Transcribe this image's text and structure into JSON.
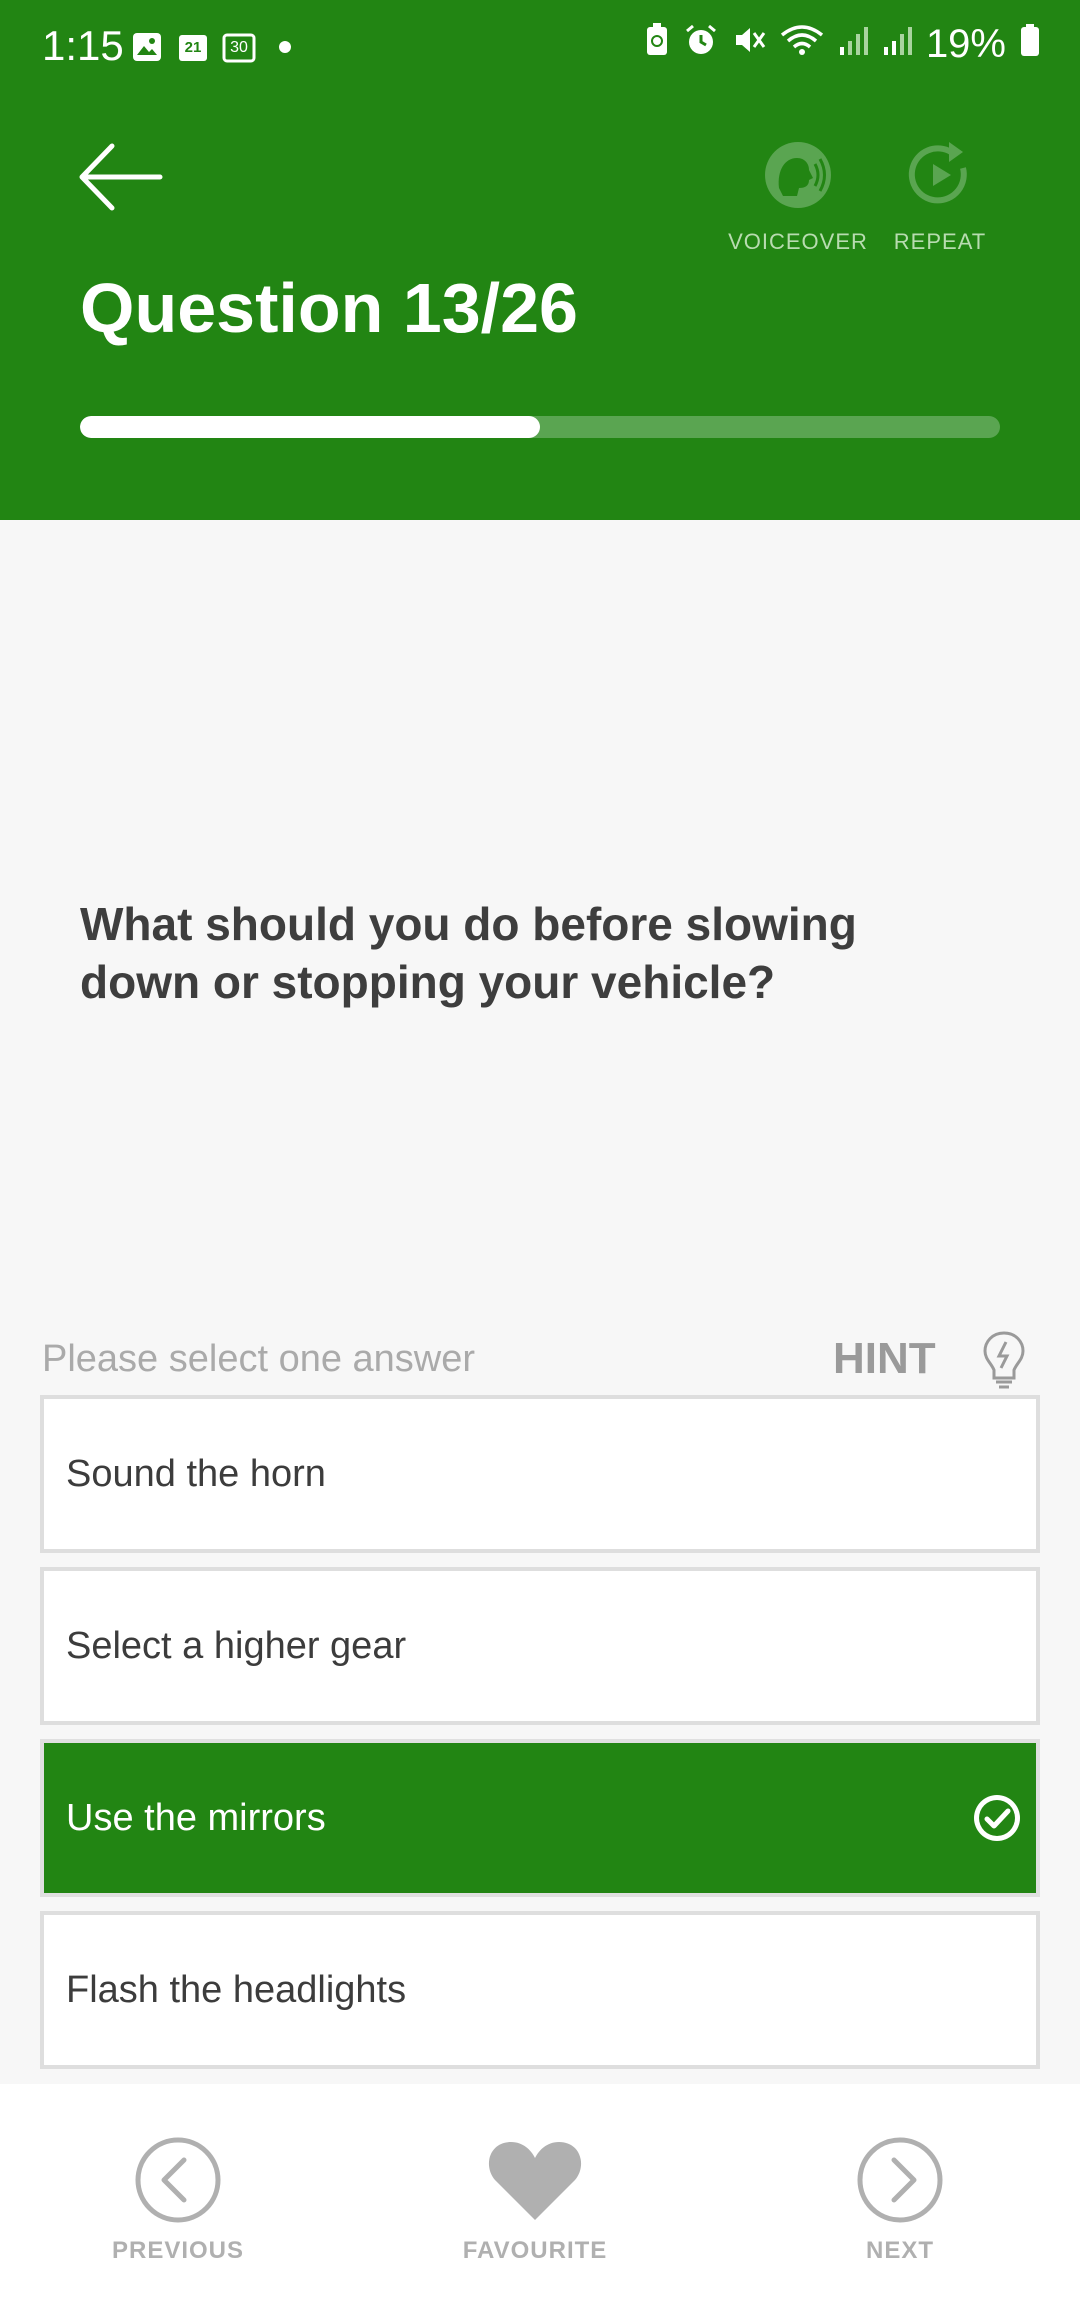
{
  "status": {
    "time": "1:15",
    "calendar1": "21",
    "calendar2": "30",
    "battery": "19%"
  },
  "header": {
    "title": "Question 13/26",
    "voiceover_label": "VOICEOVER",
    "repeat_label": "REPEAT",
    "progress": 0.5,
    "color": "#228513"
  },
  "question": {
    "text": "What should you do before slowing down or stopping your vehicle?"
  },
  "instruction": "Please select one answer",
  "hint_label": "HINT",
  "answers": [
    {
      "text": "Sound the horn",
      "selected": false
    },
    {
      "text": "Select a higher gear",
      "selected": false
    },
    {
      "text": "Use the mirrors",
      "selected": true
    },
    {
      "text": "Flash the headlights",
      "selected": false
    }
  ],
  "nav": {
    "previous": "PREVIOUS",
    "favourite": "FAVOURITE",
    "next": "NEXT"
  }
}
